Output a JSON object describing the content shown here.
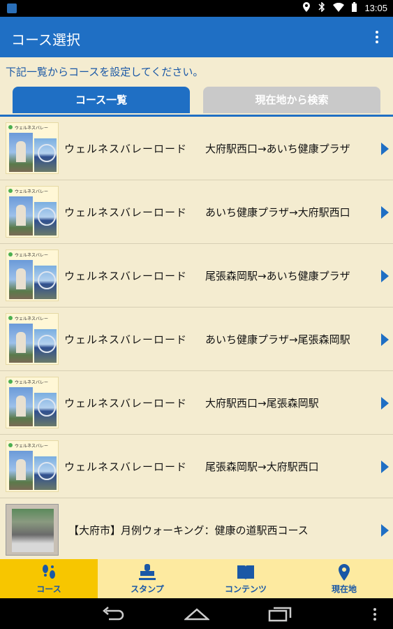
{
  "statusbar": {
    "time": "13:05"
  },
  "appbar": {
    "title": "コース選択"
  },
  "instruction": "下記一覧からコースを設定してください。",
  "tabs": [
    {
      "label": "コース一覧"
    },
    {
      "label": "現在地から検索"
    }
  ],
  "thumb_logo_text": "ウェルネスバレー",
  "courses": [
    {
      "name": "ウェルネスバレーロード",
      "route": "大府駅西口→あいち健康プラザ"
    },
    {
      "name": "ウェルネスバレーロード",
      "route": "あいち健康プラザ→大府駅西口"
    },
    {
      "name": "ウェルネスバレーロード",
      "route": "尾張森岡駅→あいち健康プラザ"
    },
    {
      "name": "ウェルネスバレーロード",
      "route": "あいち健康プラザ→尾張森岡駅"
    },
    {
      "name": "ウェルネスバレーロード",
      "route": "大府駅西口→尾張森岡駅"
    },
    {
      "name": "ウェルネスバレーロード",
      "route": "尾張森岡駅→大府駅西口"
    }
  ],
  "special_course": {
    "title": "【大府市】月例ウォーキング：健康の道駅西コース"
  },
  "bottom_nav": [
    {
      "label": "コース",
      "icon": "footprints-icon"
    },
    {
      "label": "スタンプ",
      "icon": "stamp-icon"
    },
    {
      "label": "コンテンツ",
      "icon": "book-icon"
    },
    {
      "label": "現在地",
      "icon": "location-pin-icon"
    }
  ],
  "colors": {
    "primary": "#1f6fc4",
    "background": "#f4ecd0",
    "nav_active": "#f7c600",
    "nav_bg": "#fdeaa0"
  }
}
